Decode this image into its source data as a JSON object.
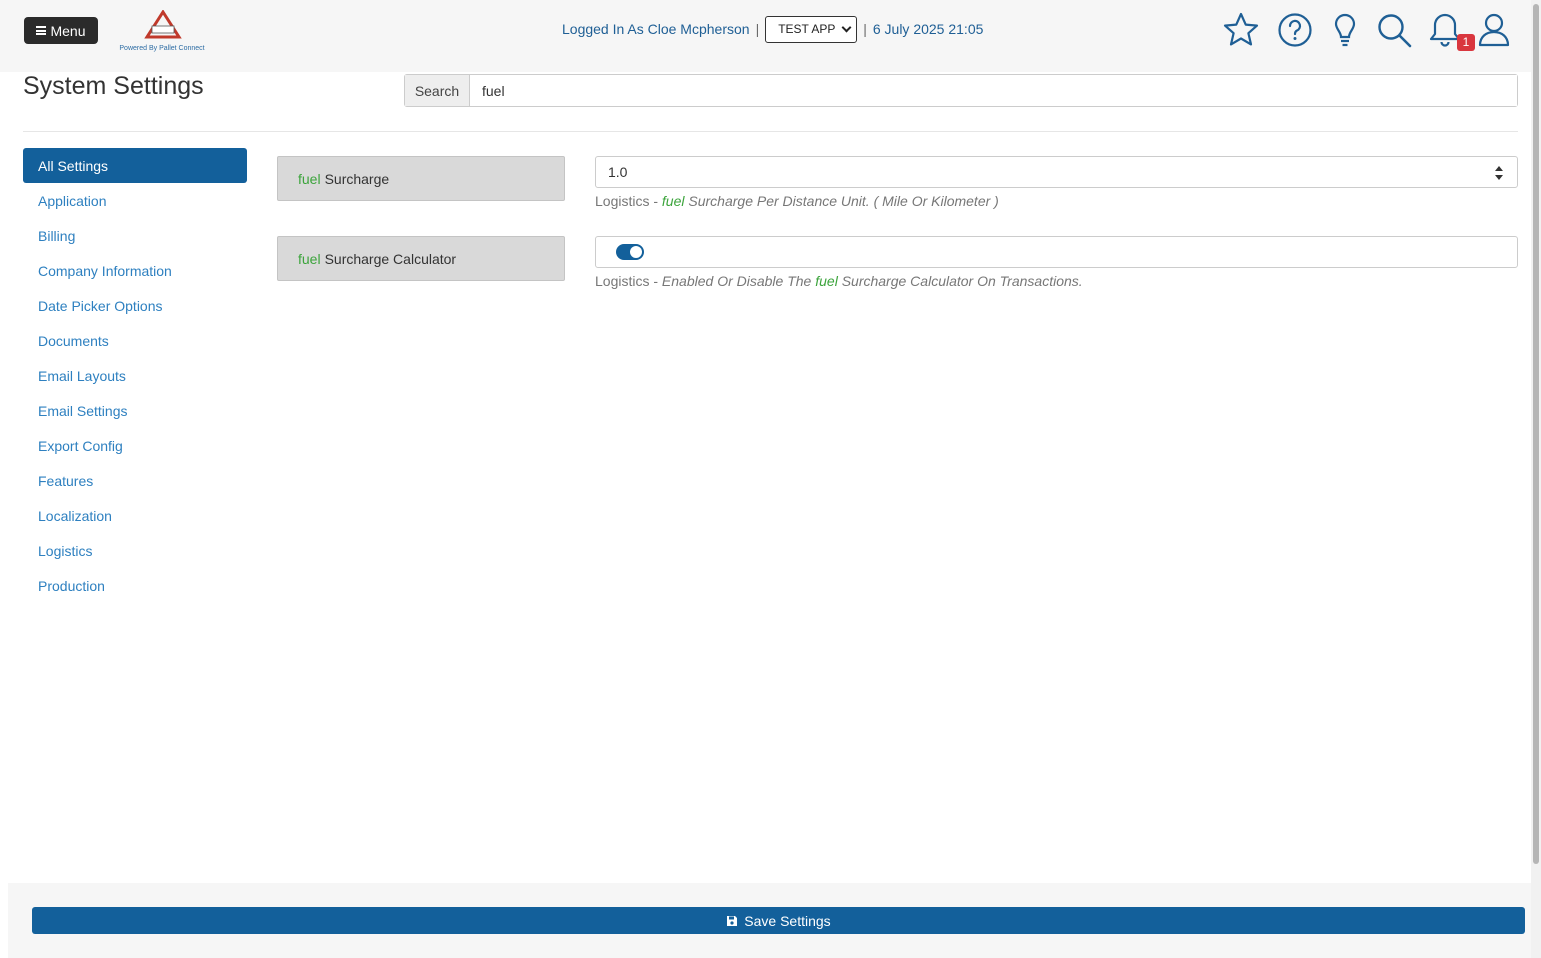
{
  "header": {
    "menu_label": "Menu",
    "logo": {
      "brand_text": "PALLET CONNECT",
      "stamp_text": "TEST",
      "powered_by": "Powered By Pallet Connect"
    },
    "session_text": "Logged In As Cloe Mcpherson",
    "separator": "|",
    "app_select": {
      "selected": "TEST APP"
    },
    "datetime": "6 July 2025 21:05",
    "icons": [
      "star-icon",
      "help-icon",
      "lightbulb-icon",
      "search-icon",
      "bell-icon",
      "user-icon"
    ],
    "notification_count": "1"
  },
  "page": {
    "title": "System Settings",
    "search": {
      "addon_label": "Search",
      "value": "fuel"
    }
  },
  "sidebar": {
    "items": [
      {
        "label": "All Settings",
        "active": true
      },
      {
        "label": "Application"
      },
      {
        "label": "Billing"
      },
      {
        "label": "Company Information"
      },
      {
        "label": "Date Picker Options"
      },
      {
        "label": "Documents"
      },
      {
        "label": "Email Layouts"
      },
      {
        "label": "Email Settings"
      },
      {
        "label": "Export Config"
      },
      {
        "label": "Features"
      },
      {
        "label": "Localization"
      },
      {
        "label": "Logistics"
      },
      {
        "label": "Production"
      }
    ]
  },
  "settings": [
    {
      "highlight": "fuel",
      "label_rest": "Surcharge",
      "value": "1.0",
      "help_category": "Logistics",
      "help_dash": " - ",
      "help_before": "",
      "help_highlight": "fuel",
      "help_after": " Surcharge Per Distance Unit.  ( Mile Or Kilometer )"
    },
    {
      "highlight": "fuel",
      "label_rest": "Surcharge Calculator",
      "toggle_on": true,
      "help_category": "Logistics",
      "help_dash": " - ",
      "help_before": "Enabled Or Disable The ",
      "help_highlight": "fuel",
      "help_after": " Surcharge Calculator On Transactions."
    }
  ],
  "footer": {
    "save_label": "Save Settings"
  },
  "colors": {
    "primary": "#13609b",
    "highlight": "#3ca43c",
    "badge": "#d9363e",
    "link": "#2e80c0"
  }
}
